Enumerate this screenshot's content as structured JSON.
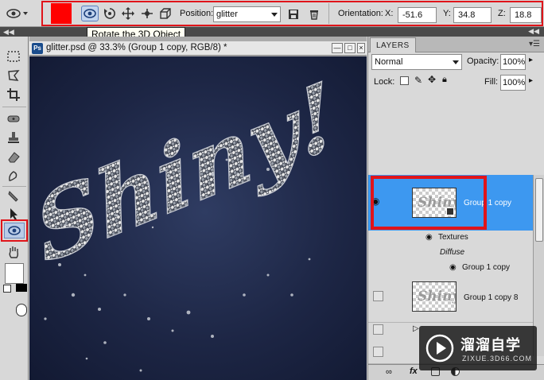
{
  "options_bar": {
    "tooltip": "Rotate the 3D Object",
    "position_label": "Position:",
    "position_value": "glitter",
    "orientation_label": "Orientation:",
    "x_label": "X:",
    "x_value": "-51.6",
    "y_label": "Y:",
    "y_value": "34.8",
    "z_label": "Z:",
    "z_value": "18.8"
  },
  "document": {
    "title": "glitter.psd @ 33.3% (Group 1 copy, RGB/8) *",
    "canvas_text": "Shiny!",
    "ps_badge": "Ps"
  },
  "layers_panel": {
    "tab_label": "LAYERS",
    "blend_mode": "Normal",
    "opacity_label": "Opacity:",
    "opacity_value": "100%",
    "lock_label": "Lock:",
    "fill_label": "Fill:",
    "fill_value": "100%",
    "layers": [
      {
        "name": "Group 1 copy",
        "selected": true
      },
      {
        "name": "Textures"
      },
      {
        "name": "Diffuse"
      },
      {
        "name": "Group 1 copy"
      },
      {
        "name": "Group 1 copy 8"
      }
    ],
    "thumb_text": "Shiny",
    "fx_label": "fx"
  },
  "watermark": {
    "brand": "溜溜自学",
    "url": "ZIXUE.3D66.COM"
  },
  "colors": {
    "selection_blue": "#3d98f0",
    "highlight_red": "#e0141a",
    "foreground_swatch": "#ff0000"
  },
  "icons": [
    "rotate-3d-icon",
    "roll-3d-icon",
    "drag-3d-icon",
    "slide-3d-icon",
    "scale-3d-icon",
    "save-icon",
    "trash-icon",
    "eye-icon",
    "link-icon",
    "fx-icon",
    "mask-icon",
    "adjust-icon",
    "folder-icon",
    "new-layer-icon",
    "delete-icon"
  ]
}
